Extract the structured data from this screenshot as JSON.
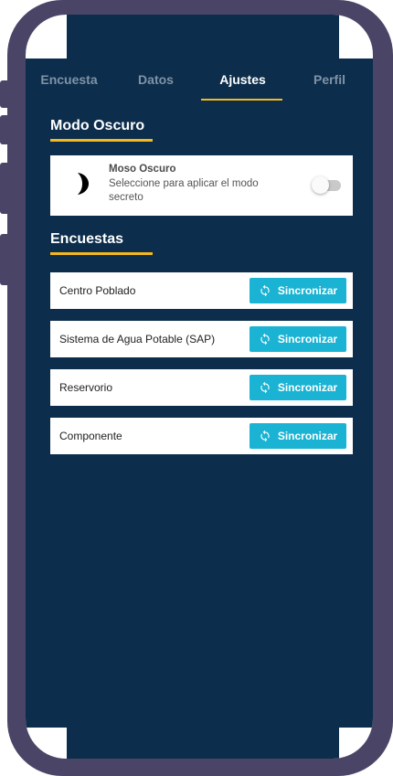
{
  "tabs": [
    {
      "label": "Encuesta",
      "active": false
    },
    {
      "label": "Datos",
      "active": false
    },
    {
      "label": "Ajustes",
      "active": true
    },
    {
      "label": "Perfil",
      "active": false
    }
  ],
  "dark_mode": {
    "section_title": "Modo Oscuro",
    "title": "Moso Oscuro",
    "description": "Seleccione para aplicar el modo secreto",
    "icon": "moon-icon",
    "enabled": false
  },
  "surveys": {
    "section_title": "Encuestas",
    "sync_label": "Sincronizar",
    "sync_icon": "sync-icon",
    "items": [
      {
        "label": "Centro Poblado"
      },
      {
        "label": "Sistema de Agua Potable (SAP)"
      },
      {
        "label": "Reservorio"
      },
      {
        "label": "Componente"
      }
    ]
  },
  "colors": {
    "background": "#0c2d4b",
    "accent": "#f5b81f",
    "button": "#1ab3d3",
    "frame": "#4a4566"
  }
}
